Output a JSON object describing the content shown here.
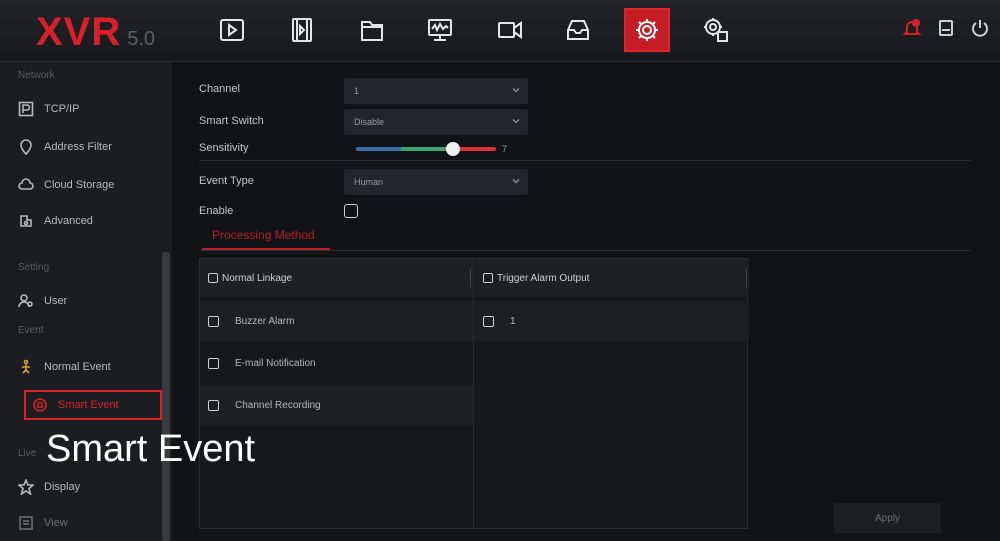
{
  "app": {
    "logo": "XVR",
    "version": "5.0"
  },
  "topnav": {
    "icons": [
      "playback-icon",
      "video-clip-icon",
      "folder-icon",
      "monitor-icon",
      "camera-icon",
      "storage-icon",
      "settings-icon",
      "system-settings-icon"
    ],
    "active": "settings-icon",
    "right_icons": [
      "alarm-bell-icon",
      "disk-icon",
      "power-icon"
    ]
  },
  "sidebar": {
    "sections": [
      {
        "label": "Network",
        "items": [
          "TCP/IP",
          "Address Filter",
          "Cloud Storage",
          "Advanced"
        ]
      },
      {
        "label": "Setting",
        "items": [
          "User"
        ]
      },
      {
        "label": "Event",
        "items": [
          "Normal Event",
          "Smart Event"
        ]
      },
      {
        "label": "Live",
        "items": [
          "Display",
          "View"
        ]
      }
    ],
    "network_label": "Network",
    "setting_label": "Setting",
    "event_label": "Event",
    "live_label": "Live",
    "tcpip": "TCP/IP",
    "address_filter": "Address Filter",
    "cloud_storage": "Cloud Storage",
    "advanced": "Advanced",
    "user": "User",
    "normal_event": "Normal Event",
    "smart_event": "Smart Event",
    "display": "Display",
    "view": "View",
    "active": "Smart Event"
  },
  "form": {
    "channel_label": "Channel",
    "channel_value": "1",
    "smart_switch_label": "Smart Switch",
    "smart_switch_value": "Disable",
    "sensitivity_label": "Sensitivity",
    "sensitivity_value": "7",
    "sensitivity_fraction": 0.7,
    "event_type_label": "Event Type",
    "event_type_value": "Human",
    "enable_label": "Enable",
    "enable_checked": false
  },
  "tabs": {
    "processing_method": "Processing Method"
  },
  "linkage": {
    "normal_linkage_header": "Normal Linkage",
    "trigger_alarm_header": "Trigger Alarm Output",
    "normal_items": [
      "Buzzer Alarm",
      "E-mail Notification",
      "Channel Recording"
    ],
    "alarm_items": [
      "1"
    ]
  },
  "buttons": {
    "apply": "Apply"
  },
  "overlay": {
    "title": "Smart Event"
  },
  "colors": {
    "accent": "#d8202a"
  }
}
